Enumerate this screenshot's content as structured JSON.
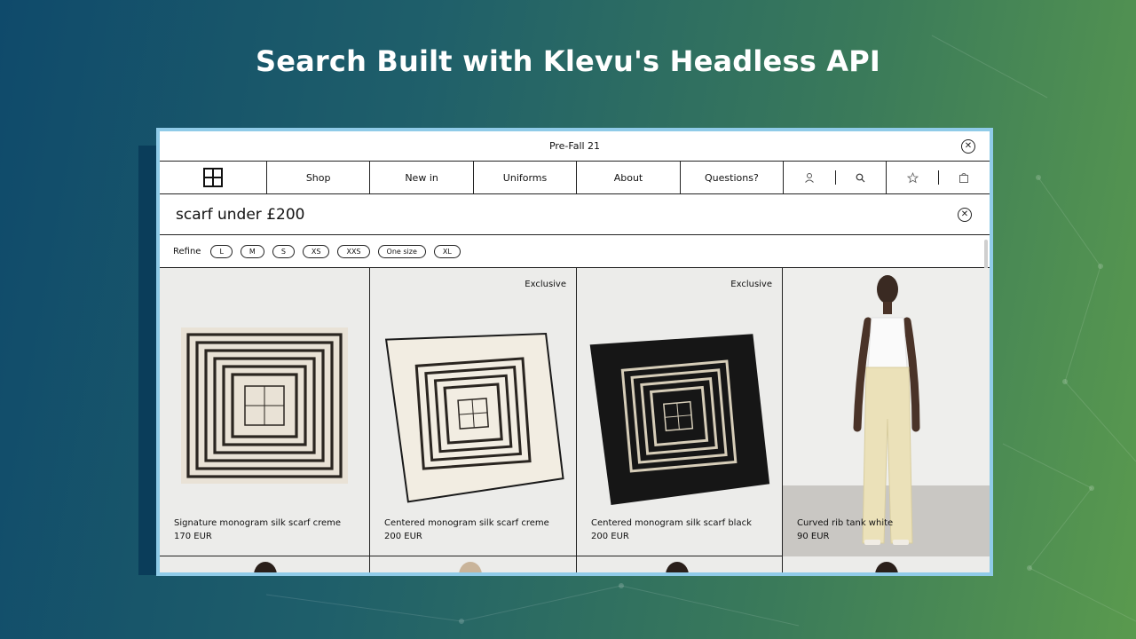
{
  "headline": "Search Built with Klevu's Headless API",
  "promo": {
    "text": "Pre-Fall 21"
  },
  "nav": {
    "items": [
      "Shop",
      "New in",
      "Uniforms",
      "About",
      "Questions?"
    ]
  },
  "search": {
    "query": "scarf under £200"
  },
  "refine": {
    "label": "Refine",
    "sizes": [
      "L",
      "M",
      "S",
      "XS",
      "XXS",
      "One size",
      "XL"
    ]
  },
  "products": [
    {
      "name": "Signature monogram silk scarf creme",
      "price": "170 EUR",
      "badge": ""
    },
    {
      "name": "Centered monogram silk scarf creme",
      "price": "200 EUR",
      "badge": "Exclusive"
    },
    {
      "name": "Centered monogram silk scarf black",
      "price": "200 EUR",
      "badge": "Exclusive"
    },
    {
      "name": "Curved rib tank white",
      "price": "90 EUR",
      "badge": ""
    }
  ],
  "colors": {
    "frame": "#8fcbe8",
    "bg_start": "#0f4a6b",
    "bg_end": "#5a9a4e"
  }
}
